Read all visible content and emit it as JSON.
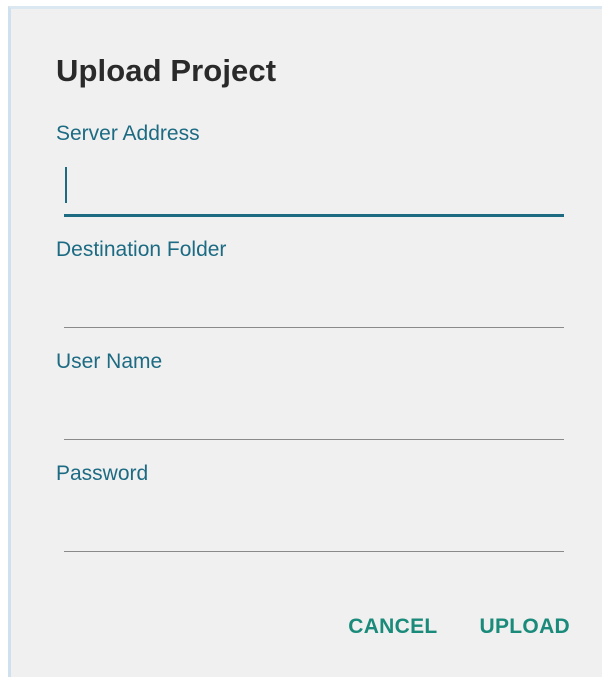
{
  "dialog": {
    "title": "Upload Project",
    "fields": [
      {
        "label": "Server Address",
        "value": "",
        "focused": true
      },
      {
        "label": "Destination Folder",
        "value": "",
        "focused": false
      },
      {
        "label": "User Name",
        "value": "",
        "focused": false
      },
      {
        "label": "Password",
        "value": "",
        "focused": false
      }
    ],
    "buttons": {
      "cancel": "CANCEL",
      "upload": "UPLOAD"
    }
  },
  "colors": {
    "accent": "#1d6b83",
    "button_text": "#1a8a7a",
    "background": "#f0f0f0"
  }
}
